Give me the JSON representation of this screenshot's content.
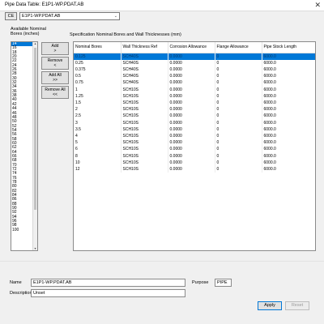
{
  "window": {
    "title": "Pipe Data Table: E1P1-WP.PDAT.AB",
    "close_glyph": "✕"
  },
  "ce": {
    "button_label": "CE",
    "selected": "E1P1-WP.PDAT.AB",
    "chevron": "⌄"
  },
  "available": {
    "label_line1": "Available Nominal",
    "label_line2": "Bores (inches)",
    "items": [
      "14",
      "16",
      "18",
      "20",
      "22",
      "24",
      "26",
      "28",
      "30",
      "32",
      "34",
      "36",
      "38",
      "40",
      "42",
      "44",
      "46",
      "48",
      "50",
      "52",
      "54",
      "56",
      "58",
      "60",
      "62",
      "64",
      "66",
      "68",
      "70",
      "72",
      "74",
      "76",
      "78",
      "80",
      "82",
      "84",
      "86",
      "88",
      "90",
      "92",
      "94",
      "96",
      "98",
      "100"
    ],
    "selected_index": 0
  },
  "buttons": {
    "add": [
      "Add",
      ">"
    ],
    "remove": [
      "Remove",
      "<"
    ],
    "add_all": [
      "Add All",
      ">>"
    ],
    "remove_all": [
      "Remove All",
      "<<"
    ]
  },
  "spec": {
    "label": "Specification Nominal Bores and Wall Thicknesses (mm)",
    "columns": [
      "Nominal Bores",
      "Wall Thickness Ref",
      "Corrosion Allowance",
      "Flange Allowance",
      "Pipe Stock Length"
    ],
    "selected_row": 0,
    "rows": [
      [
        "0.125",
        "SCH40S",
        "0.0000",
        "0",
        "6000.0"
      ],
      [
        "0.25",
        "SCH40S",
        "0.0000",
        "0",
        "6000.0"
      ],
      [
        "0.375",
        "SCH40S",
        "0.0000",
        "0",
        "6000.0"
      ],
      [
        "0.5",
        "SCH40S",
        "0.0000",
        "0",
        "6000.0"
      ],
      [
        "0.75",
        "SCH40S",
        "0.0000",
        "0",
        "6000.0"
      ],
      [
        "1",
        "SCH10S",
        "0.0000",
        "0",
        "6000.0"
      ],
      [
        "1.25",
        "SCH10S",
        "0.0000",
        "0",
        "6000.0"
      ],
      [
        "1.5",
        "SCH10S",
        "0.0000",
        "0",
        "6000.0"
      ],
      [
        "2",
        "SCH10S",
        "0.0000",
        "0",
        "6000.0"
      ],
      [
        "2.5",
        "SCH10S",
        "0.0000",
        "0",
        "6000.0"
      ],
      [
        "3",
        "SCH10S",
        "0.0000",
        "0",
        "6000.0"
      ],
      [
        "3.5",
        "SCH10S",
        "0.0000",
        "0",
        "6000.0"
      ],
      [
        "4",
        "SCH10S",
        "0.0000",
        "0",
        "6000.0"
      ],
      [
        "5",
        "SCH10S",
        "0.0000",
        "0",
        "6000.0"
      ],
      [
        "6",
        "SCH10S",
        "0.0000",
        "0",
        "6000.0"
      ],
      [
        "8",
        "SCH10S",
        "0.0000",
        "0",
        "6000.0"
      ],
      [
        "10",
        "SCH10S",
        "0.0000",
        "0",
        "6000.0"
      ],
      [
        "12",
        "SCH10S",
        "0.0000",
        "0",
        "6000.0"
      ]
    ]
  },
  "form": {
    "name_label": "Name",
    "name_value": "E1P1-WP.PDAT.AB",
    "purpose_label": "Purpose",
    "purpose_value": "PIPE",
    "description_label": "Description",
    "description_value": "Unset",
    "apply_label": "Apply",
    "reset_label": "Reset"
  },
  "colors": {
    "selection": "#0078d7"
  }
}
